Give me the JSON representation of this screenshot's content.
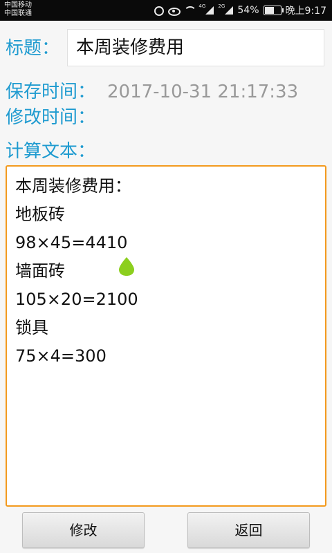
{
  "status_bar": {
    "carrier1": "中国移动",
    "carrier2": "中国联通",
    "network1": "4G",
    "network2": "2G",
    "battery": "54%",
    "time": "晚上9:17"
  },
  "form": {
    "title_label": "标题：",
    "title_value": "本周装修费用",
    "save_time_label": "保存时间：",
    "save_time_value": "2017-10-31 21:17:33",
    "modify_time_label": "修改时间：",
    "calc_label": "计算文本："
  },
  "calc_text": {
    "lines": [
      "本周装修费用：",
      "地板砖",
      "98×45=4410",
      "墙面砖",
      "105×20=2100",
      "锁具",
      "75×4=300"
    ]
  },
  "buttons": {
    "modify": "修改",
    "return": "返回"
  },
  "colors": {
    "label": "#1f9bd0",
    "textarea_border": "#f39a1e",
    "cursor_handle": "#8ccf1e"
  }
}
